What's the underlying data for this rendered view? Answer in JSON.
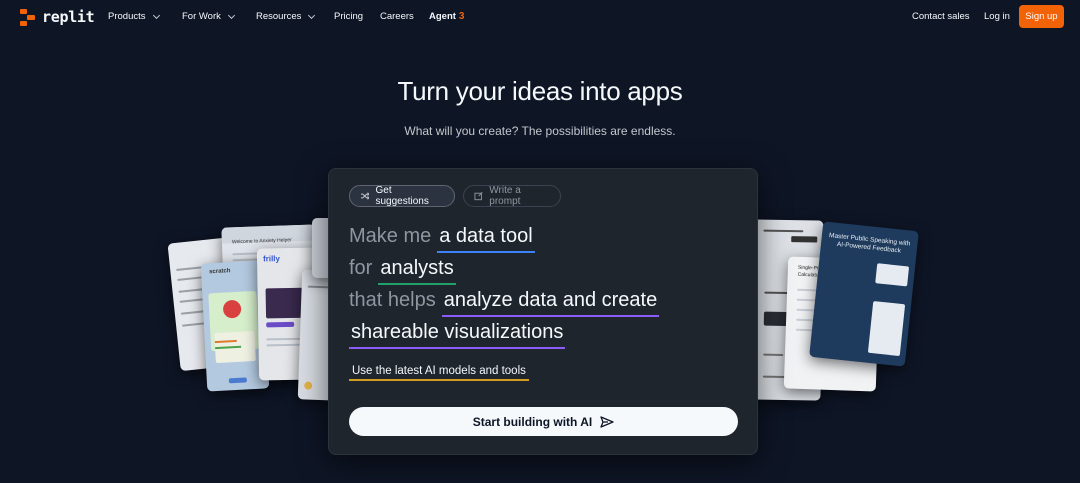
{
  "brand": {
    "name": "replit",
    "accent": "#f26207"
  },
  "nav": {
    "products": "Products",
    "for_work": "For Work",
    "resources": "Resources",
    "pricing": "Pricing",
    "careers": "Careers",
    "agent": "Agent",
    "agent_badge": "3",
    "contact_sales": "Contact sales",
    "login": "Log in",
    "signup": "Sign up"
  },
  "hero": {
    "title": "Turn your ideas into apps",
    "subtitle": "What will you create? The possibilities are endless."
  },
  "prompt": {
    "tab_suggestions": "Get suggestions",
    "tab_write": "Write a prompt",
    "line1_prefix": "Make me",
    "line1_value": "a data tool",
    "line2_prefix": "for",
    "line2_value": "analysts",
    "line3_prefix": "that helps",
    "line3_value": "analyze data and create",
    "line4_value": "shareable visualizations",
    "chip": "Use the latest AI models and tools",
    "start_button": "Start building with AI",
    "underline_colors": [
      "#3b82f6",
      "#22a06b",
      "#8b5cf6",
      "#8b5cf6",
      "#d69a21"
    ]
  },
  "preview_cards": {
    "anxiety_helper": "Welcome to Anxiety Helper",
    "scratch_logo": "scratch",
    "frilly_logo": "frilly",
    "speaking_title": "Master Public Speaking with AI-Powered Feedback",
    "rental_calc": "Single-Property Lease Calculator"
  }
}
